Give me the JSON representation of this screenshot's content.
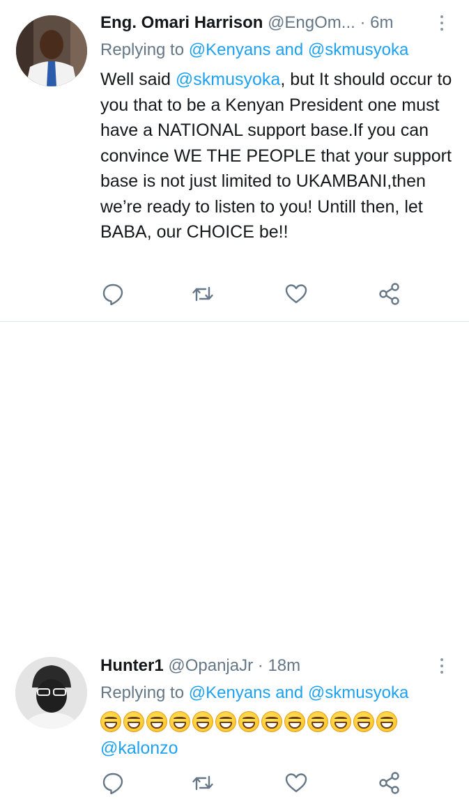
{
  "tweets": [
    {
      "display_name": "Eng. Omari Harrison",
      "handle": "@EngOm...",
      "separator": "·",
      "time": "6m",
      "replying_prefix": "Replying to",
      "replying_to_1": "@Kenyans",
      "replying_and": "and",
      "replying_to_2": "@skmusyoka",
      "text_before_mention": "Well said ",
      "mention": "@skmusyoka",
      "text_after_mention": ", but It should occur to you that to be a Kenyan President one must have a NATIONAL support base.If you can convince WE THE PEOPLE that your support base is not just limited to UKAMBANI,then we’re ready to listen to you! Untill then, let BABA, our CHOICE be!!",
      "actions": {
        "reply_icon": "reply-icon",
        "retweet_icon": "retweet-icon",
        "like_icon": "heart-icon",
        "share_icon": "share-icon"
      }
    },
    {
      "display_name": "Hunter1",
      "handle": "@OpanjaJr",
      "separator": "·",
      "time": "18m",
      "replying_prefix": "Replying to",
      "replying_to_1": "@Kenyans",
      "replying_and": "and",
      "replying_to_2": "@skmusyoka",
      "emoji_count": 13,
      "emoji_name": "grinning-squinting-face",
      "mention": "@kalonzo",
      "actions": {
        "reply_icon": "reply-icon",
        "retweet_icon": "retweet-icon",
        "like_icon": "heart-icon",
        "share_icon": "share-icon"
      }
    }
  ],
  "colors": {
    "link": "#1da1f2",
    "secondary": "#657786",
    "text": "#14171a",
    "divider": "#e1e8ed"
  }
}
